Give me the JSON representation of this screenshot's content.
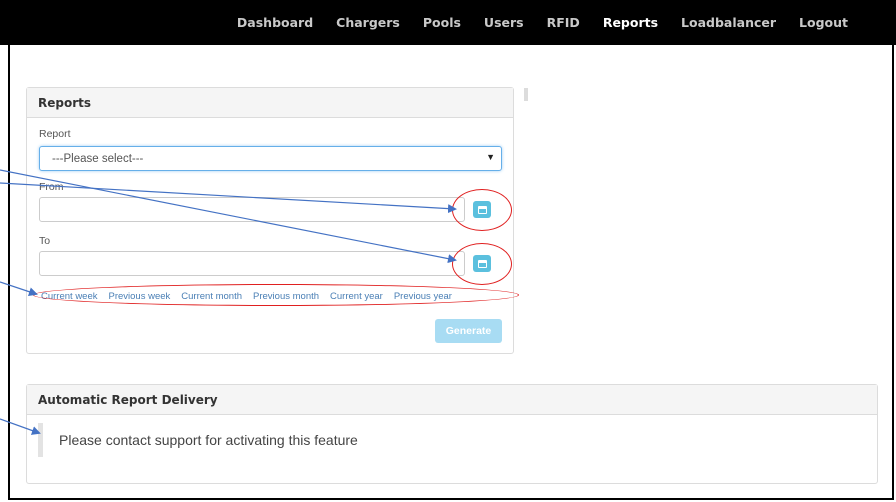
{
  "nav": {
    "items": [
      {
        "label": "Dashboard",
        "active": false
      },
      {
        "label": "Chargers",
        "active": false
      },
      {
        "label": "Pools",
        "active": false
      },
      {
        "label": "Users",
        "active": false
      },
      {
        "label": "RFID",
        "active": false
      },
      {
        "label": "Reports",
        "active": true
      },
      {
        "label": "Loadbalancer",
        "active": false
      },
      {
        "label": "Logout",
        "active": false
      }
    ]
  },
  "reports_panel": {
    "title": "Reports",
    "report_label": "Report",
    "report_select_value": "---Please select---",
    "from_label": "From",
    "from_value": "",
    "to_label": "To",
    "to_value": "",
    "calendar_icon": "calendar-icon",
    "quick_links": [
      "Current week",
      "Previous week",
      "Current month",
      "Previous month",
      "Current year",
      "Previous year"
    ],
    "generate_label": "Generate"
  },
  "delivery_panel": {
    "title": "Automatic Report Delivery",
    "message": "Please contact support for activating this feature"
  },
  "colors": {
    "navbar": "#000000",
    "link": "#4a7fb5",
    "calendar_button": "#5bc0de",
    "generate_button": "#a8dcf3",
    "annotation_ring": "#e02020",
    "annotation_arrow": "#4472c4"
  }
}
